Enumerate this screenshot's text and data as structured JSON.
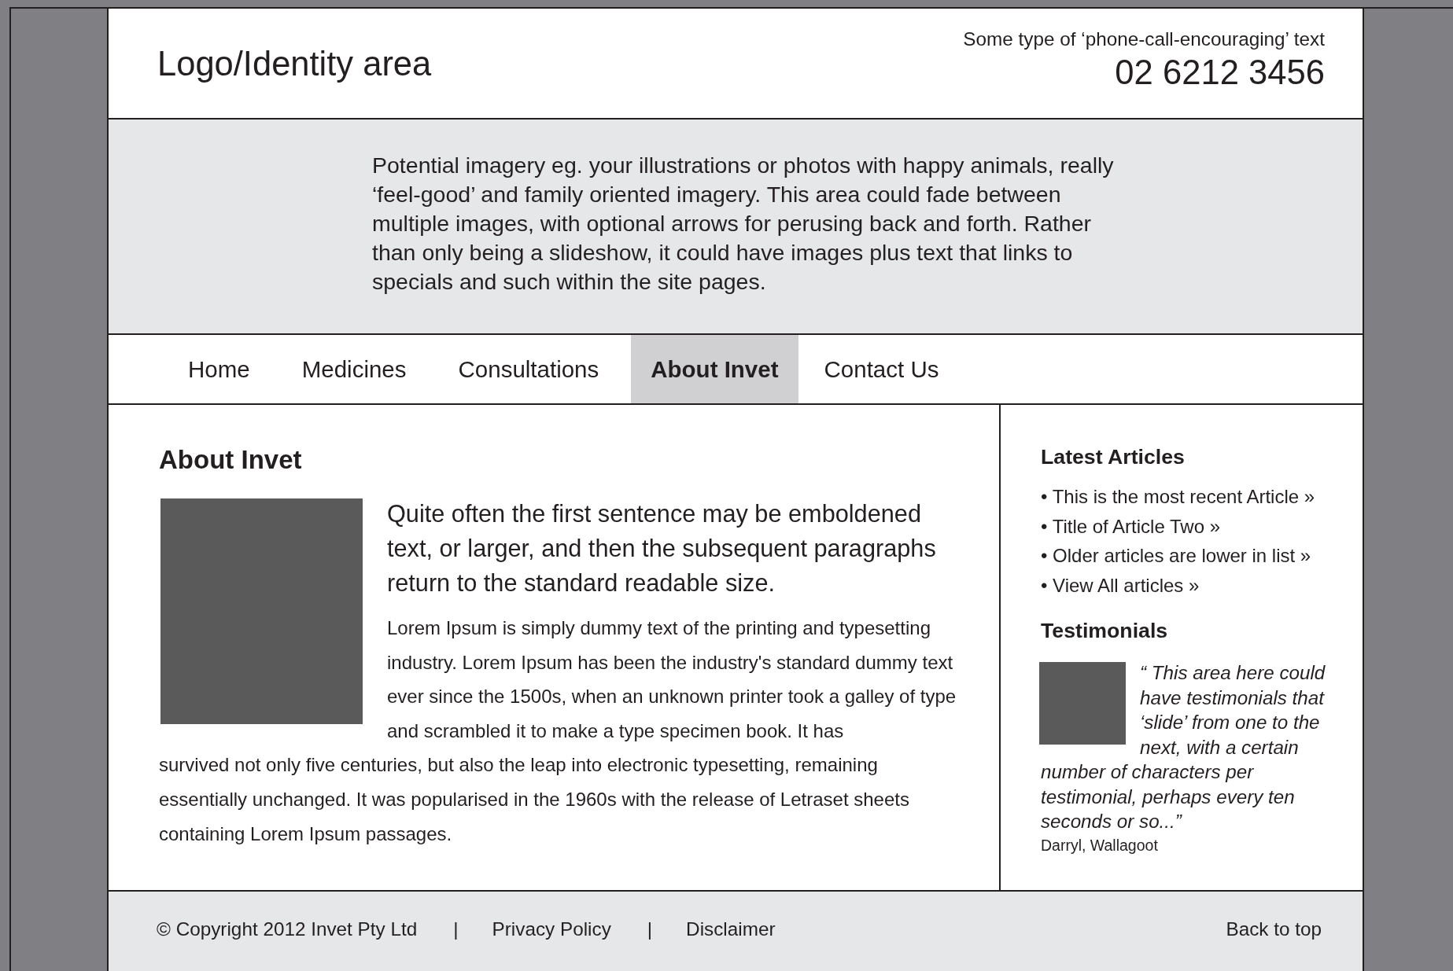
{
  "header": {
    "logo": "Logo/Identity area",
    "tagline": "Some type of ‘phone-call-encouraging’ text",
    "phone": "02 6212 3456"
  },
  "banner": {
    "text": "Potential imagery eg. your illustrations or photos with happy animals, really ‘feel-good’ and family oriented imagery. This area could fade between multiple images, with optional arrows for perusing back and forth. Rather than only being a slideshow, it could have images plus text that links to specials and such within the site pages."
  },
  "nav": [
    {
      "label": "Home",
      "selected": false
    },
    {
      "label": "Medicines",
      "selected": false
    },
    {
      "label": "Consultations",
      "selected": false
    },
    {
      "label": "About Invet",
      "selected": true
    },
    {
      "label": "Contact Us",
      "selected": false
    }
  ],
  "main": {
    "heading": "About Invet",
    "intro": "Quite often the first sentence may be emboldened text, or larger, and then the subsequent paragraphs return to the standard readable size.",
    "body": [
      "Lorem Ipsum is simply dummy text of the printing and typesetting industry. Lorem Ipsum has been the industry's standard dummy text ever since the 1500s, when an unknown printer took a galley of type and scrambled it to make a type specimen book. It has",
      "survived not only five centuries, but also the leap into electronic typesetting, remaining essentially unchanged. It was popularised in the 1960s with the release of Letraset sheets containing Lorem Ipsum passages."
    ]
  },
  "sidebar": {
    "articles_heading": "Latest Articles",
    "articles": [
      "• This is the most recent Article »",
      "• Title of Article Two »",
      "• Older articles are lower in list »",
      "• View All articles »"
    ],
    "testimonials_heading": "Testimonials",
    "quote": [
      "“ This area here could have testimonials that ‘slide’ from one to the next, with a certain",
      "number of characters per testimonial, perhaps every ten seconds or so...”"
    ],
    "author": "Darryl, Wallagoot"
  },
  "footer": {
    "copyright": "© Copyright 2012 Invet Pty Ltd",
    "links": [
      "Privacy Policy",
      "Disclaimer"
    ],
    "separator": "|",
    "back_to_top": "Back to top"
  }
}
